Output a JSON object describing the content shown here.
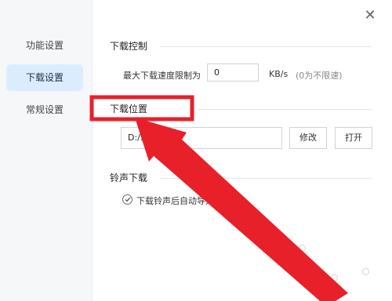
{
  "window": {
    "close_icon": "close-icon"
  },
  "sidebar": {
    "items": [
      {
        "label": "功能设置",
        "active": false
      },
      {
        "label": "下载设置",
        "active": true
      },
      {
        "label": "常规设置",
        "active": false
      }
    ]
  },
  "download_control": {
    "title": "下载控制",
    "speed_label": "最大下载速度限制为",
    "speed_value": "0",
    "unit": "KB/s",
    "hint": "(0为不限速)"
  },
  "download_location": {
    "title": "下载位置",
    "path_value": "D:/S       Data",
    "modify_button": "修改",
    "open_button": "打开"
  },
  "ringtone_download": {
    "title": "铃声下载",
    "checkbox_label": "下载铃声后自动导入到设",
    "checked": true
  },
  "annotation": {
    "color": "#e8202a"
  }
}
